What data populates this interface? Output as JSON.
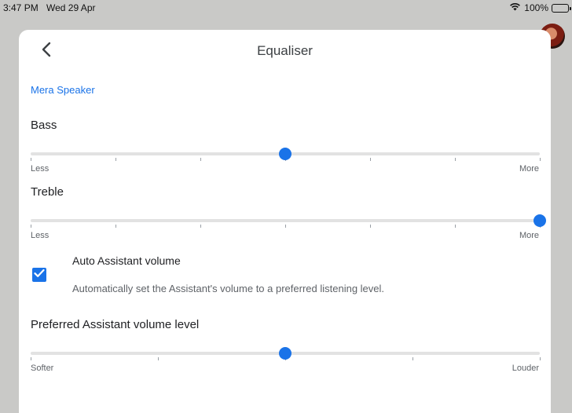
{
  "status_bar": {
    "time": "3:47 PM",
    "date": "Wed 29 Apr",
    "battery": "100%",
    "icons": [
      "wifi-icon",
      "battery-icon"
    ]
  },
  "header": {
    "title": "Equaliser",
    "back_icon": "chevron-left-icon"
  },
  "device_name": "Mera Speaker",
  "bass": {
    "label": "Bass",
    "min_label": "Less",
    "max_label": "More",
    "value": 0.5,
    "ticks": 7
  },
  "treble": {
    "label": "Treble",
    "min_label": "Less",
    "max_label": "More",
    "value": 1.0,
    "ticks": 7
  },
  "auto_volume": {
    "title": "Auto Assistant volume",
    "description": "Automatically set the Assistant's volume to a preferred listening level.",
    "checked": true
  },
  "preferred_volume": {
    "label": "Preferred Assistant volume level",
    "min_label": "Softer",
    "max_label": "Louder",
    "value": 0.5,
    "ticks": 5
  },
  "colors": {
    "accent": "#1a73e8",
    "track": "#e2e2e2",
    "backdrop": "#c9c9c7"
  }
}
